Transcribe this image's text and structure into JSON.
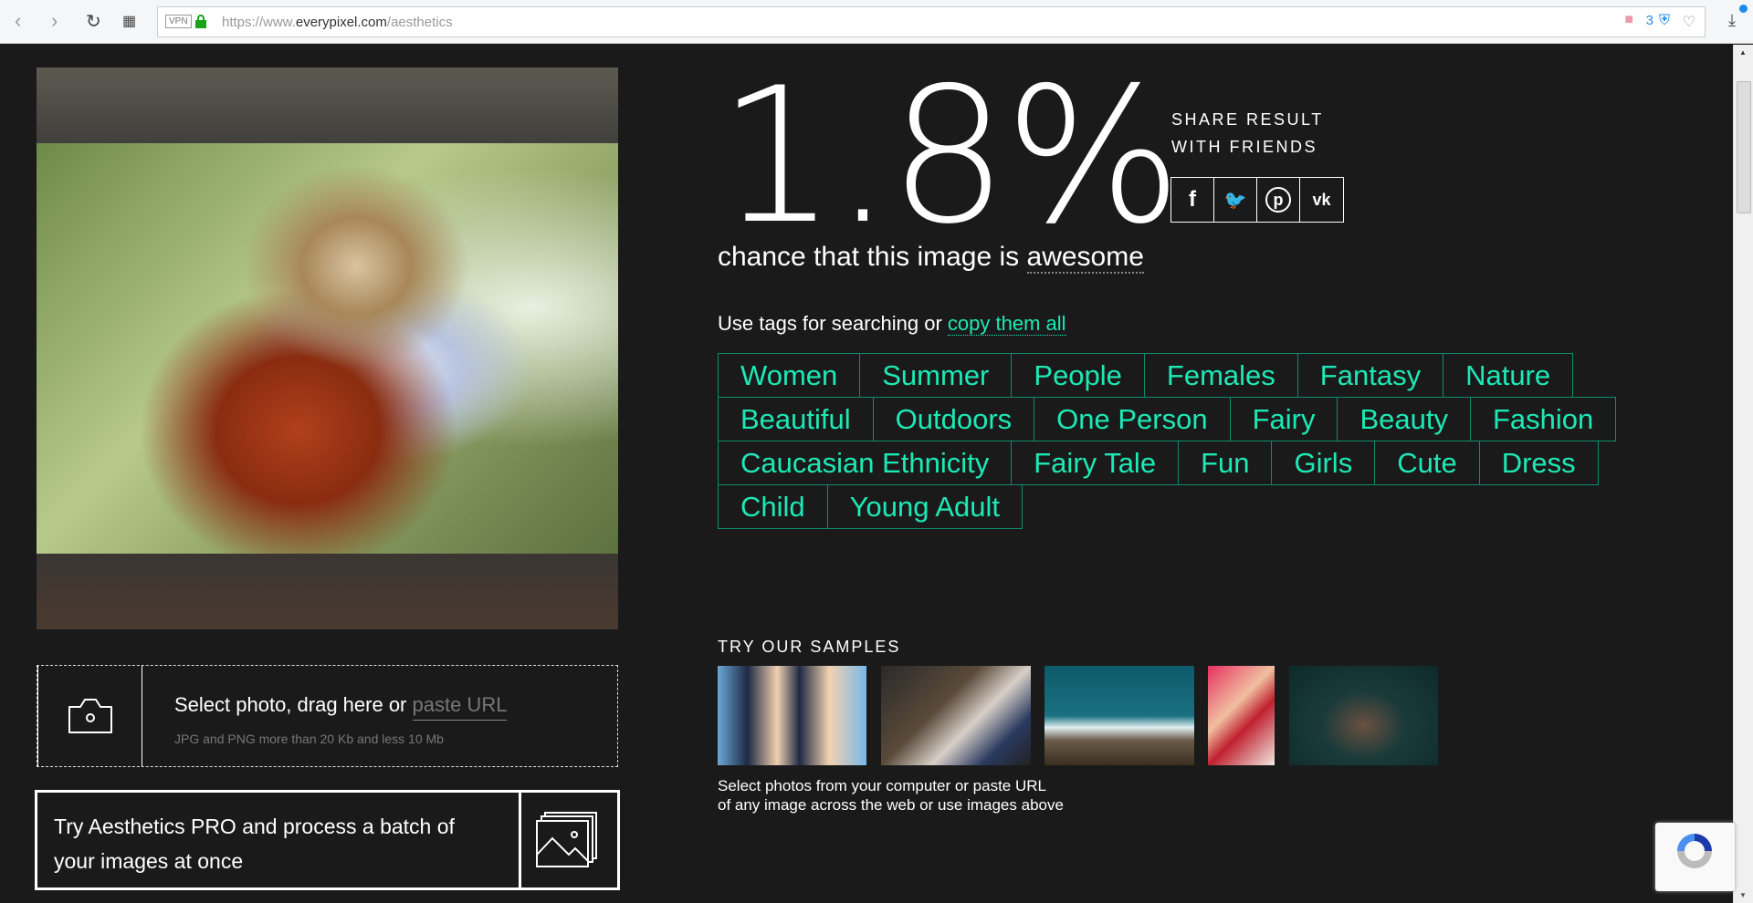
{
  "browser": {
    "vpn": "VPN",
    "url_prefix": "https://www.",
    "url_domain": "everypixel.com",
    "url_path": "/aesthetics",
    "badge_count": "3"
  },
  "result": {
    "score": "1.8%",
    "chance_prefix": "chance that this image is ",
    "chance_word": "awesome"
  },
  "share": {
    "line1": "SHARE RESULT",
    "line2": "WITH FRIENDS",
    "buttons": [
      "f",
      "t",
      "p",
      "vk"
    ]
  },
  "tags": {
    "intro": "Use tags for searching or ",
    "copy_link": "copy them all",
    "rows": [
      [
        "Women",
        "Summer",
        "People",
        "Females",
        "Fantasy",
        "Nature"
      ],
      [
        "Beautiful",
        "Outdoors",
        "One Person",
        "Fairy",
        "Beauty",
        "Fashion"
      ],
      [
        "Caucasian Ethnicity",
        "Fairy Tale",
        "Fun",
        "Girls",
        "Cute",
        "Dress"
      ],
      [
        "Child",
        "Young Adult"
      ]
    ]
  },
  "samples": {
    "title": "TRY OUR SAMPLES",
    "text1": "Select photos from your computer or paste URL",
    "text2": "of any image across the web or use images above"
  },
  "upload": {
    "text": "Select photo, drag here or ",
    "paste": "paste URL",
    "hint": "JPG and PNG more than 20 Kb and less 10 Mb"
  },
  "pro": {
    "line1": "Try Aesthetics PRO and process a batch of",
    "line2": "your images at once"
  },
  "colors": {
    "accent": "#1de9b6",
    "bg": "#1a1a1a"
  }
}
